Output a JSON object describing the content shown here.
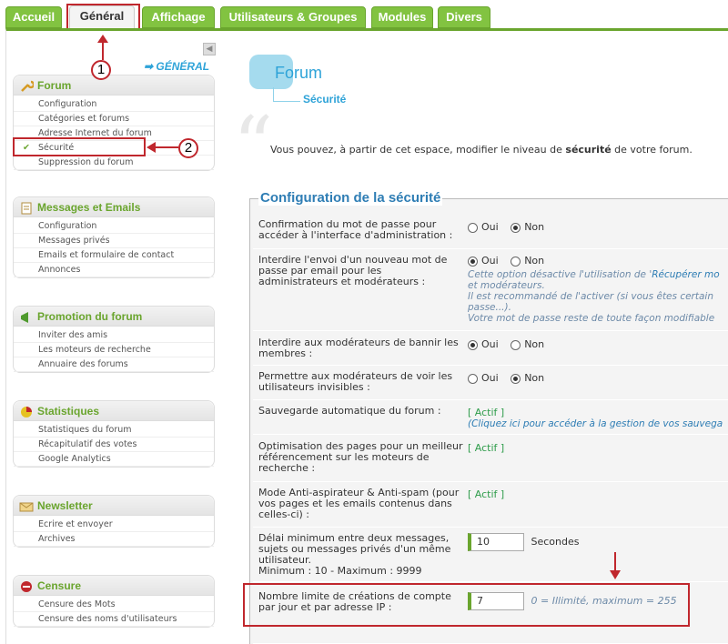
{
  "tabs": [
    {
      "label": "Accueil"
    },
    {
      "label": "Général"
    },
    {
      "label": "Affichage"
    },
    {
      "label": "Utilisateurs & Groupes"
    },
    {
      "label": "Modules"
    },
    {
      "label": "Divers"
    }
  ],
  "sidebar": {
    "general_link": "➡ GÉNÉRAL",
    "boxes": [
      {
        "title": "Forum",
        "icon": "wrench-icon",
        "items": [
          "Configuration",
          "Catégories et forums",
          "Adresse Internet du forum",
          "Sécurité",
          "Suppression du forum"
        ]
      },
      {
        "title": "Messages et Emails",
        "icon": "document-icon",
        "items": [
          "Configuration",
          "Messages privés",
          "Emails et formulaire de contact",
          "Annonces"
        ]
      },
      {
        "title": "Promotion du forum",
        "icon": "megaphone-icon",
        "items": [
          "Inviter des amis",
          "Les moteurs de recherche",
          "Annuaire des forums"
        ]
      },
      {
        "title": "Statistiques",
        "icon": "chart-icon",
        "items": [
          "Statistiques du forum",
          "Récapitulatif des votes",
          "Google Analytics"
        ]
      },
      {
        "title": "Newsletter",
        "icon": "newsletter-icon",
        "items": [
          "Ecrire et envoyer",
          "Archives"
        ]
      },
      {
        "title": "Censure",
        "icon": "censure-icon",
        "items": [
          "Censure des Mots",
          "Censure des noms d'utilisateurs"
        ]
      }
    ]
  },
  "annotations": {
    "one": "1",
    "two": "2"
  },
  "main": {
    "title": "Forum",
    "subtitle": "Sécurité",
    "intro_a": "Vous pouvez, à partir de cet espace, modifier le niveau de ",
    "intro_b": "sécurité",
    "intro_c": " de votre forum.",
    "legend": "Configuration de la sécurité",
    "oui": "Oui",
    "non": "Non",
    "rows": {
      "r1": {
        "label": "Confirmation du mot de passe pour accéder à l'interface d'administration :",
        "selected": "Non"
      },
      "r2": {
        "label": "Interdire l'envoi d'un nouveau mot de passe par email pour les administrateurs et modérateurs :",
        "selected": "Oui",
        "note1a": "Cette option désactive l'utilisation de '",
        "note1b": "Récupérer mo",
        "note2": "et modérateurs.",
        "note3": "Il est recommandé de l'activer (si vous êtes certain",
        "note4": "passe...).",
        "note5": "Votre mot de passe reste de toute façon modifiable"
      },
      "r3": {
        "label": "Interdire aux modérateurs de bannir les membres :",
        "selected": "Oui"
      },
      "r4": {
        "label": "Permettre aux modérateurs de voir les utilisateurs invisibles :",
        "selected": "Non"
      },
      "r5": {
        "label": "Sauvegarde automatique du forum :",
        "actif": "[ Actif ]",
        "note": "(Cliquez ici pour accéder à la gestion de vos sauvega"
      },
      "r6": {
        "label": "Optimisation des pages pour un meilleur référencement sur les moteurs de recherche :",
        "actif": "[ Actif ]"
      },
      "r7": {
        "label": "Mode Anti-aspirateur & Anti-spam (pour vos pages et les emails contenus dans celles-ci) :",
        "actif": "[ Actif ]"
      },
      "r8": {
        "label": "Délai minimum entre deux messages, sujets ou messages privés d'un même utilisateur.",
        "label2": "Minimum : 10 - Maximum : 9999",
        "value": "10",
        "unit": "Secondes"
      },
      "r9": {
        "label": "Nombre limite de créations de compte par jour et par adresse IP :",
        "value": "7",
        "hint": "0 = Illimité, maximum = 255"
      }
    }
  }
}
